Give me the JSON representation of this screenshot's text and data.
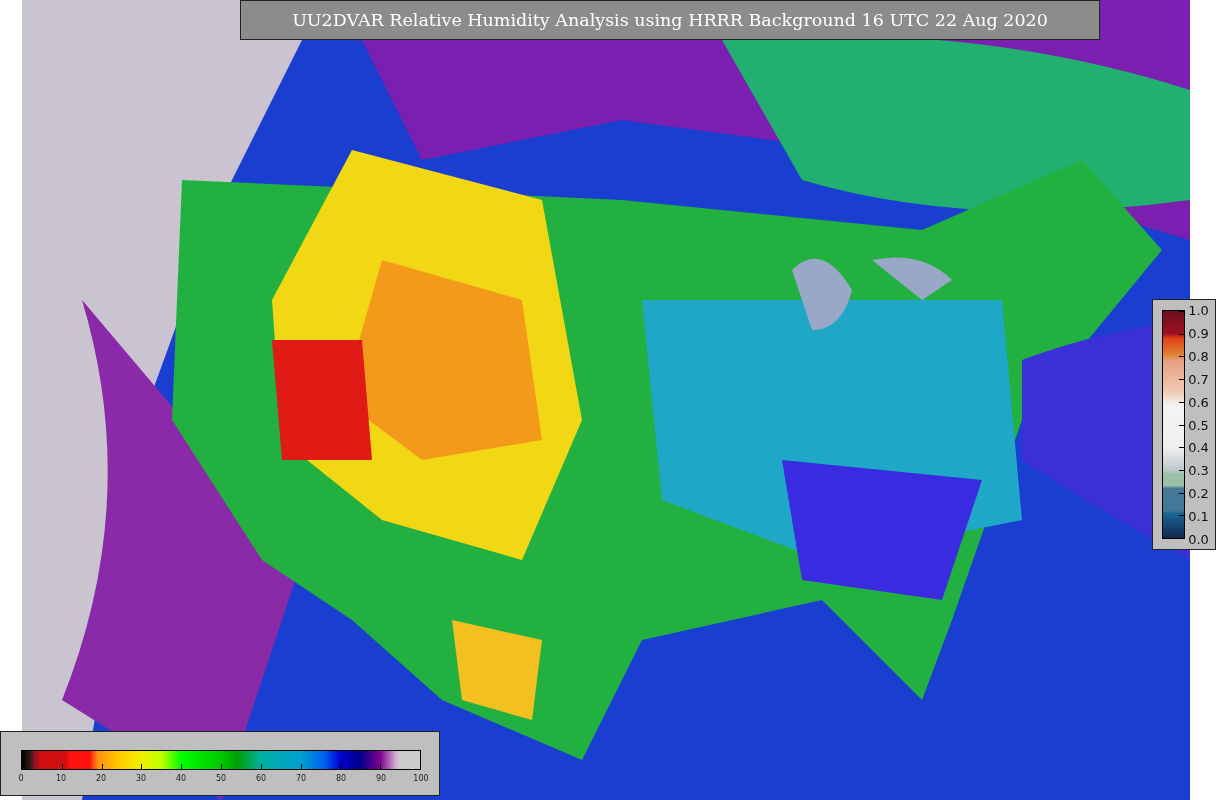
{
  "title": "UU2DVAR Relative Humidity Analysis using HRRR Background 16 UTC 22 Aug 2020",
  "humidity_colorbar": {
    "ticks": [
      "0",
      "10",
      "20",
      "30",
      "40",
      "50",
      "60",
      "70",
      "80",
      "90",
      "100"
    ]
  },
  "ratio_colorbar": {
    "ticks": [
      "1.0",
      "0.9",
      "0.8",
      "0.7",
      "0.6",
      "0.5",
      "0.4",
      "0.3",
      "0.2",
      "0.1",
      "0.0"
    ]
  }
}
